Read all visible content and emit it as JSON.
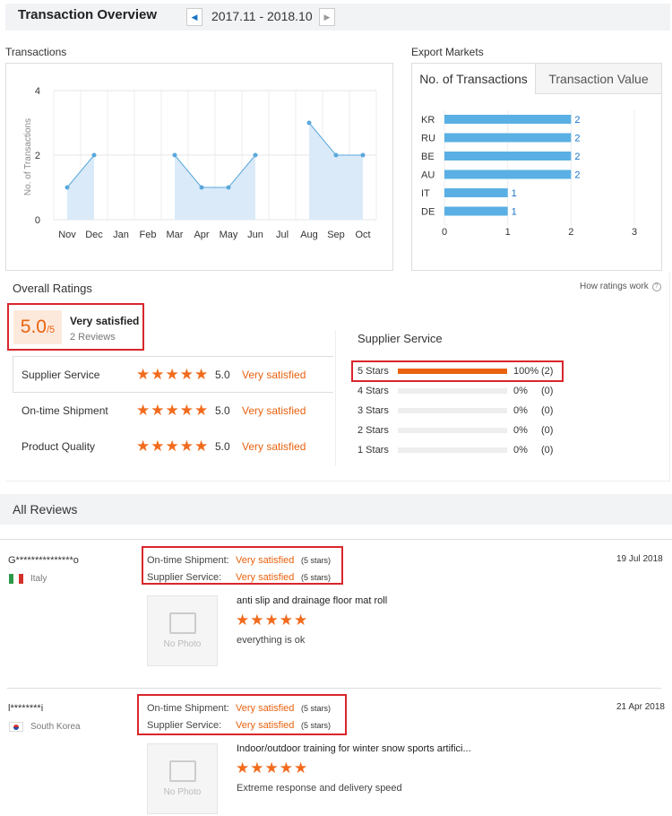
{
  "header": {
    "title": "Transaction Overview",
    "date_range": "2017.11 - 2018.10"
  },
  "transactions": {
    "label": "Transactions"
  },
  "chart_data": [
    {
      "type": "area",
      "ylabel": "No. of Transactions",
      "categories": [
        "Nov",
        "Dec",
        "Jan",
        "Feb",
        "Mar",
        "Apr",
        "May",
        "Jun",
        "Jul",
        "Aug",
        "Sep",
        "Oct"
      ],
      "values": [
        1,
        2,
        null,
        null,
        2,
        1,
        1,
        2,
        null,
        3,
        2,
        2
      ],
      "y_ticks": [
        "0",
        "2",
        "4"
      ],
      "ylim": [
        0,
        4
      ],
      "colors": {
        "line": "#5aa8dc",
        "fill": "#daeaf8",
        "point": "#5aa8dc"
      }
    },
    {
      "type": "bar",
      "orientation": "horizontal",
      "categories": [
        "KR",
        "RU",
        "BE",
        "AU",
        "IT",
        "DE"
      ],
      "values": [
        2,
        2,
        2,
        2,
        1,
        1
      ],
      "x_ticks": [
        "0",
        "1",
        "2",
        "3"
      ],
      "xlim": [
        0,
        3
      ],
      "colors": {
        "bar": "#5ab0e4"
      }
    }
  ],
  "export_markets": {
    "label": "Export Markets",
    "tabs": [
      "No. of Transactions",
      "Transaction Value"
    ]
  },
  "overall_ratings": {
    "label": "Overall Ratings",
    "how_link": "How ratings work",
    "score": "5.0",
    "score_suffix": "/5",
    "verdict": "Very satisfied",
    "reviews_count": "2 Reviews",
    "categories": [
      {
        "name": "Supplier Service",
        "score": "5.0",
        "verdict": "Very satisfied",
        "stars": 5
      },
      {
        "name": "On-time Shipment",
        "score": "5.0",
        "verdict": "Very satisfied",
        "stars": 5
      },
      {
        "name": "Product Quality",
        "score": "5.0",
        "verdict": "Very satisfied",
        "stars": 5
      }
    ]
  },
  "supplier_service": {
    "label": "Supplier Service",
    "rows": [
      {
        "label": "5 Stars",
        "fraction": 1.0,
        "pct": "100%",
        "count": "(2)"
      },
      {
        "label": "4 Stars",
        "fraction": 0,
        "pct": "0%",
        "count": "(0)"
      },
      {
        "label": "3 Stars",
        "fraction": 0,
        "pct": "0%",
        "count": "(0)"
      },
      {
        "label": "2 Stars",
        "fraction": 0,
        "pct": "0%",
        "count": "(0)"
      },
      {
        "label": "1 Stars",
        "fraction": 0,
        "pct": "0%",
        "count": "(0)"
      }
    ]
  },
  "all_reviews": {
    "label": "All Reviews",
    "no_photo": "No Photo",
    "items": [
      {
        "user": "G***************o",
        "country": "Italy",
        "date": "19 Jul 2018",
        "shipment_label": "On-time Shipment:",
        "shipment_value": "Very satisfied",
        "shipment_stars": "(5 stars)",
        "service_label": "Supplier Service:",
        "service_value": "Very satisfied",
        "service_stars": "(5 stars)",
        "product": "anti slip and drainage floor mat roll",
        "comment": "everything is ok"
      },
      {
        "user": "l********i",
        "country": "South Korea",
        "date": "21 Apr 2018",
        "shipment_label": "On-time Shipment:",
        "shipment_value": "Very satisfied",
        "shipment_stars": "(5 stars)",
        "service_label": "Supplier Service:",
        "service_value": "Very satisfied",
        "service_stars": "(5 stars)",
        "product": "Indoor/outdoor training for winter snow sports artifici...",
        "comment": "Extreme response and delivery speed"
      }
    ]
  },
  "colors": {
    "accent": "#e9620f",
    "link": "#1a73c8",
    "highlight": "#d9262c"
  }
}
